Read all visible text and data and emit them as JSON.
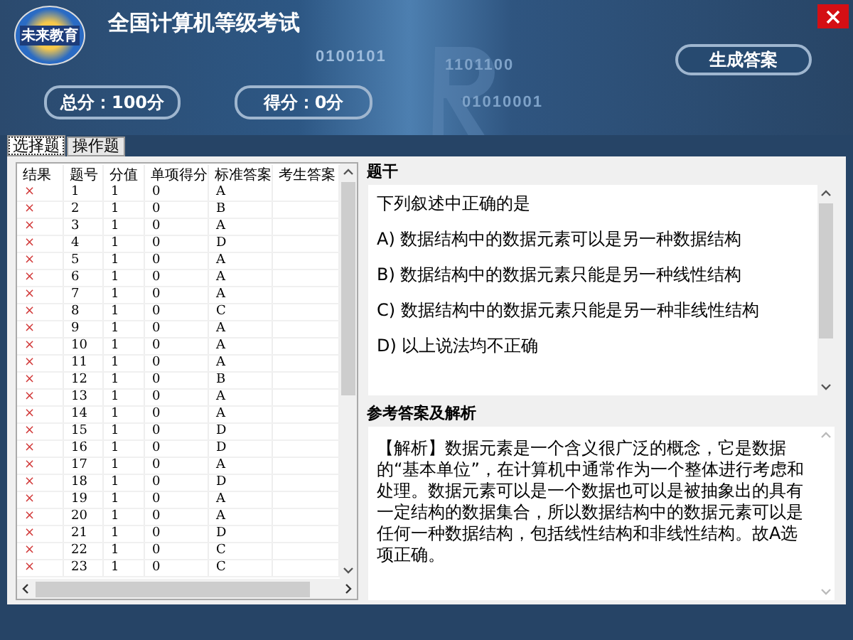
{
  "window": {
    "title": "全国计算机等级考试",
    "logo_text": "未来教育",
    "background_codes": [
      "0100101",
      "1101100",
      "01010001"
    ]
  },
  "scores": [
    {
      "label": "总分：100分"
    },
    {
      "label": "得分：0分"
    }
  ],
  "generate_button": "生成答案",
  "tabs": [
    {
      "label": "选择题",
      "selected": true
    },
    {
      "label": "操作题",
      "selected": false
    }
  ],
  "table": {
    "columns": [
      "结果",
      "题号",
      "分值",
      "单项得分",
      "标准答案",
      "考生答案"
    ],
    "rows": [
      {
        "result": "×",
        "correct": false,
        "number": "1",
        "points": "1",
        "score": "0",
        "answer": "A",
        "student": ""
      },
      {
        "result": "×",
        "correct": false,
        "number": "2",
        "points": "1",
        "score": "0",
        "answer": "B",
        "student": ""
      },
      {
        "result": "×",
        "correct": false,
        "number": "3",
        "points": "1",
        "score": "0",
        "answer": "A",
        "student": ""
      },
      {
        "result": "×",
        "correct": false,
        "number": "4",
        "points": "1",
        "score": "0",
        "answer": "D",
        "student": ""
      },
      {
        "result": "×",
        "correct": false,
        "number": "5",
        "points": "1",
        "score": "0",
        "answer": "A",
        "student": ""
      },
      {
        "result": "×",
        "correct": false,
        "number": "6",
        "points": "1",
        "score": "0",
        "answer": "A",
        "student": ""
      },
      {
        "result": "×",
        "correct": false,
        "number": "7",
        "points": "1",
        "score": "0",
        "answer": "A",
        "student": ""
      },
      {
        "result": "×",
        "correct": false,
        "number": "8",
        "points": "1",
        "score": "0",
        "answer": "C",
        "student": ""
      },
      {
        "result": "×",
        "correct": false,
        "number": "9",
        "points": "1",
        "score": "0",
        "answer": "A",
        "student": ""
      },
      {
        "result": "×",
        "correct": false,
        "number": "10",
        "points": "1",
        "score": "0",
        "answer": "A",
        "student": ""
      },
      {
        "result": "×",
        "correct": false,
        "number": "11",
        "points": "1",
        "score": "0",
        "answer": "A",
        "student": ""
      },
      {
        "result": "×",
        "correct": false,
        "number": "12",
        "points": "1",
        "score": "0",
        "answer": "B",
        "student": ""
      },
      {
        "result": "×",
        "correct": false,
        "number": "13",
        "points": "1",
        "score": "0",
        "answer": "A",
        "student": ""
      },
      {
        "result": "×",
        "correct": false,
        "number": "14",
        "points": "1",
        "score": "0",
        "answer": "A",
        "student": ""
      },
      {
        "result": "×",
        "correct": false,
        "number": "15",
        "points": "1",
        "score": "0",
        "answer": "D",
        "student": ""
      },
      {
        "result": "×",
        "correct": false,
        "number": "16",
        "points": "1",
        "score": "0",
        "answer": "D",
        "student": ""
      },
      {
        "result": "×",
        "correct": false,
        "number": "17",
        "points": "1",
        "score": "0",
        "answer": "A",
        "student": ""
      },
      {
        "result": "×",
        "correct": false,
        "number": "18",
        "points": "1",
        "score": "0",
        "answer": "D",
        "student": ""
      },
      {
        "result": "×",
        "correct": false,
        "number": "19",
        "points": "1",
        "score": "0",
        "answer": "A",
        "student": ""
      },
      {
        "result": "×",
        "correct": false,
        "number": "20",
        "points": "1",
        "score": "0",
        "answer": "A",
        "student": ""
      },
      {
        "result": "×",
        "correct": false,
        "number": "21",
        "points": "1",
        "score": "0",
        "answer": "D",
        "student": ""
      },
      {
        "result": "×",
        "correct": false,
        "number": "22",
        "points": "1",
        "score": "0",
        "answer": "C",
        "student": ""
      },
      {
        "result": "×",
        "correct": false,
        "number": "23",
        "points": "1",
        "score": "0",
        "answer": "C",
        "student": ""
      }
    ]
  },
  "question": {
    "heading": "题干",
    "lines": [
      "下列叙述中正确的是",
      "A) 数据结构中的数据元素可以是另一种数据结构",
      "B) 数据结构中的数据元素只能是另一种线性结构",
      "C) 数据结构中的数据元素只能是另一种非线性结构",
      "D) 以上说法均不正确"
    ]
  },
  "analysis": {
    "heading": "参考答案及解析",
    "text": "【解析】数据元素是一个含义很广泛的概念，它是数据的“基本单位”，在计算机中通常作为一个整体进行考虑和处理。数据元素可以是一个数据也可以是被抽象出的具有一定结构的数据集合，所以数据结构中的数据元素可以是任何一种数据结构，包括线性结构和非线性结构。故A选项正确。"
  }
}
